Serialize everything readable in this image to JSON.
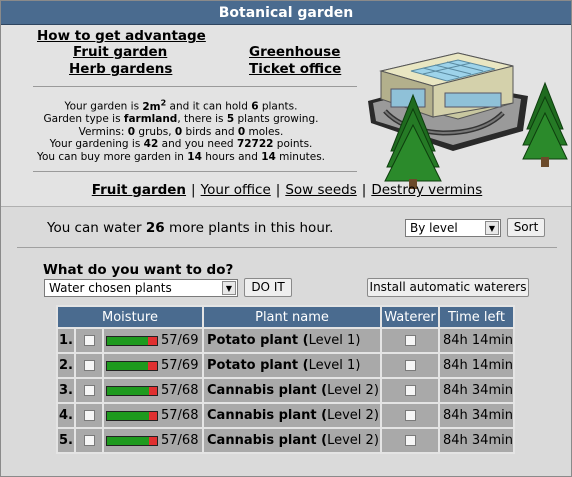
{
  "window": {
    "title": "Botanical garden"
  },
  "nav": {
    "how_to": "How to get advantage",
    "fruit_garden": "Fruit garden",
    "greenhouse": "Greenhouse",
    "herb_gardens": "Herb gardens",
    "ticket_office": "Ticket office"
  },
  "stats": {
    "size_pre": "Your garden is ",
    "size": "2m",
    "size_sup": "2",
    "hold_pre": " and it can hold ",
    "hold": "6",
    "hold_post": " plants.",
    "type_pre": "Garden type is ",
    "type": "farmland",
    "growing_pre": ", there is ",
    "growing": "5",
    "growing_post": " plants growing.",
    "vermins_pre": "Vermins: ",
    "grubs": "0",
    "grubs_post": " grubs, ",
    "birds": "0",
    "birds_post": " birds and ",
    "moles": "0",
    "moles_post": " moles.",
    "gardening_pre": "Your gardening is ",
    "gardening": "42",
    "need_pre": " and you need ",
    "need": "72722",
    "need_post": " points.",
    "buy_pre": "You can buy more garden in ",
    "hours": "14",
    "hours_post": " hours and ",
    "minutes": "14",
    "minutes_post": " minutes."
  },
  "subnav": {
    "fruit_garden": "Fruit garden",
    "sep": "|",
    "office": "Your office",
    "sow": "Sow seeds",
    "destroy": "Destroy vermins"
  },
  "water": {
    "pre": "You can water ",
    "count": "26",
    "post": " more plants in this hour.",
    "sort_select": "By level",
    "sort_button": "Sort"
  },
  "action": {
    "question": "What do you want to do?",
    "selected": "Water chosen plants",
    "do_button": "DO IT",
    "install_button": "Install automatic waterers"
  },
  "table": {
    "headers": {
      "moisture": "Moisture",
      "plant": "Plant name",
      "waterer": "Waterer",
      "time": "Time left"
    },
    "rows": [
      {
        "num": "1.",
        "moisture_text": "57/69",
        "moisture_fraction": 0.826,
        "plant": "Potato plant",
        "level_pre": " (",
        "level": "Level 1)",
        "time": "84h 14min"
      },
      {
        "num": "2.",
        "moisture_text": "57/69",
        "moisture_fraction": 0.826,
        "plant": "Potato plant",
        "level_pre": " (",
        "level": "Level 1)",
        "time": "84h 14min"
      },
      {
        "num": "3.",
        "moisture_text": "57/68",
        "moisture_fraction": 0.838,
        "plant": "Cannabis plant",
        "level_pre": " (",
        "level": "Level 2)",
        "time": "84h 34min"
      },
      {
        "num": "4.",
        "moisture_text": "57/68",
        "moisture_fraction": 0.838,
        "plant": "Cannabis plant",
        "level_pre": " (",
        "level": "Level 2)",
        "time": "84h 34min"
      },
      {
        "num": "5.",
        "moisture_text": "57/68",
        "moisture_fraction": 0.838,
        "plant": "Cannabis plant",
        "level_pre": " (",
        "level": "Level 2)",
        "time": "84h 34min"
      }
    ]
  },
  "colors": {
    "header": "#4a6b8f",
    "bar_fill": "#1e9a1e",
    "bar_empty": "#e03030",
    "cell": "#a9a9a9"
  },
  "icons": {
    "illustration": "greenhouse-illustration",
    "dropdown": "chevron-down-icon"
  }
}
